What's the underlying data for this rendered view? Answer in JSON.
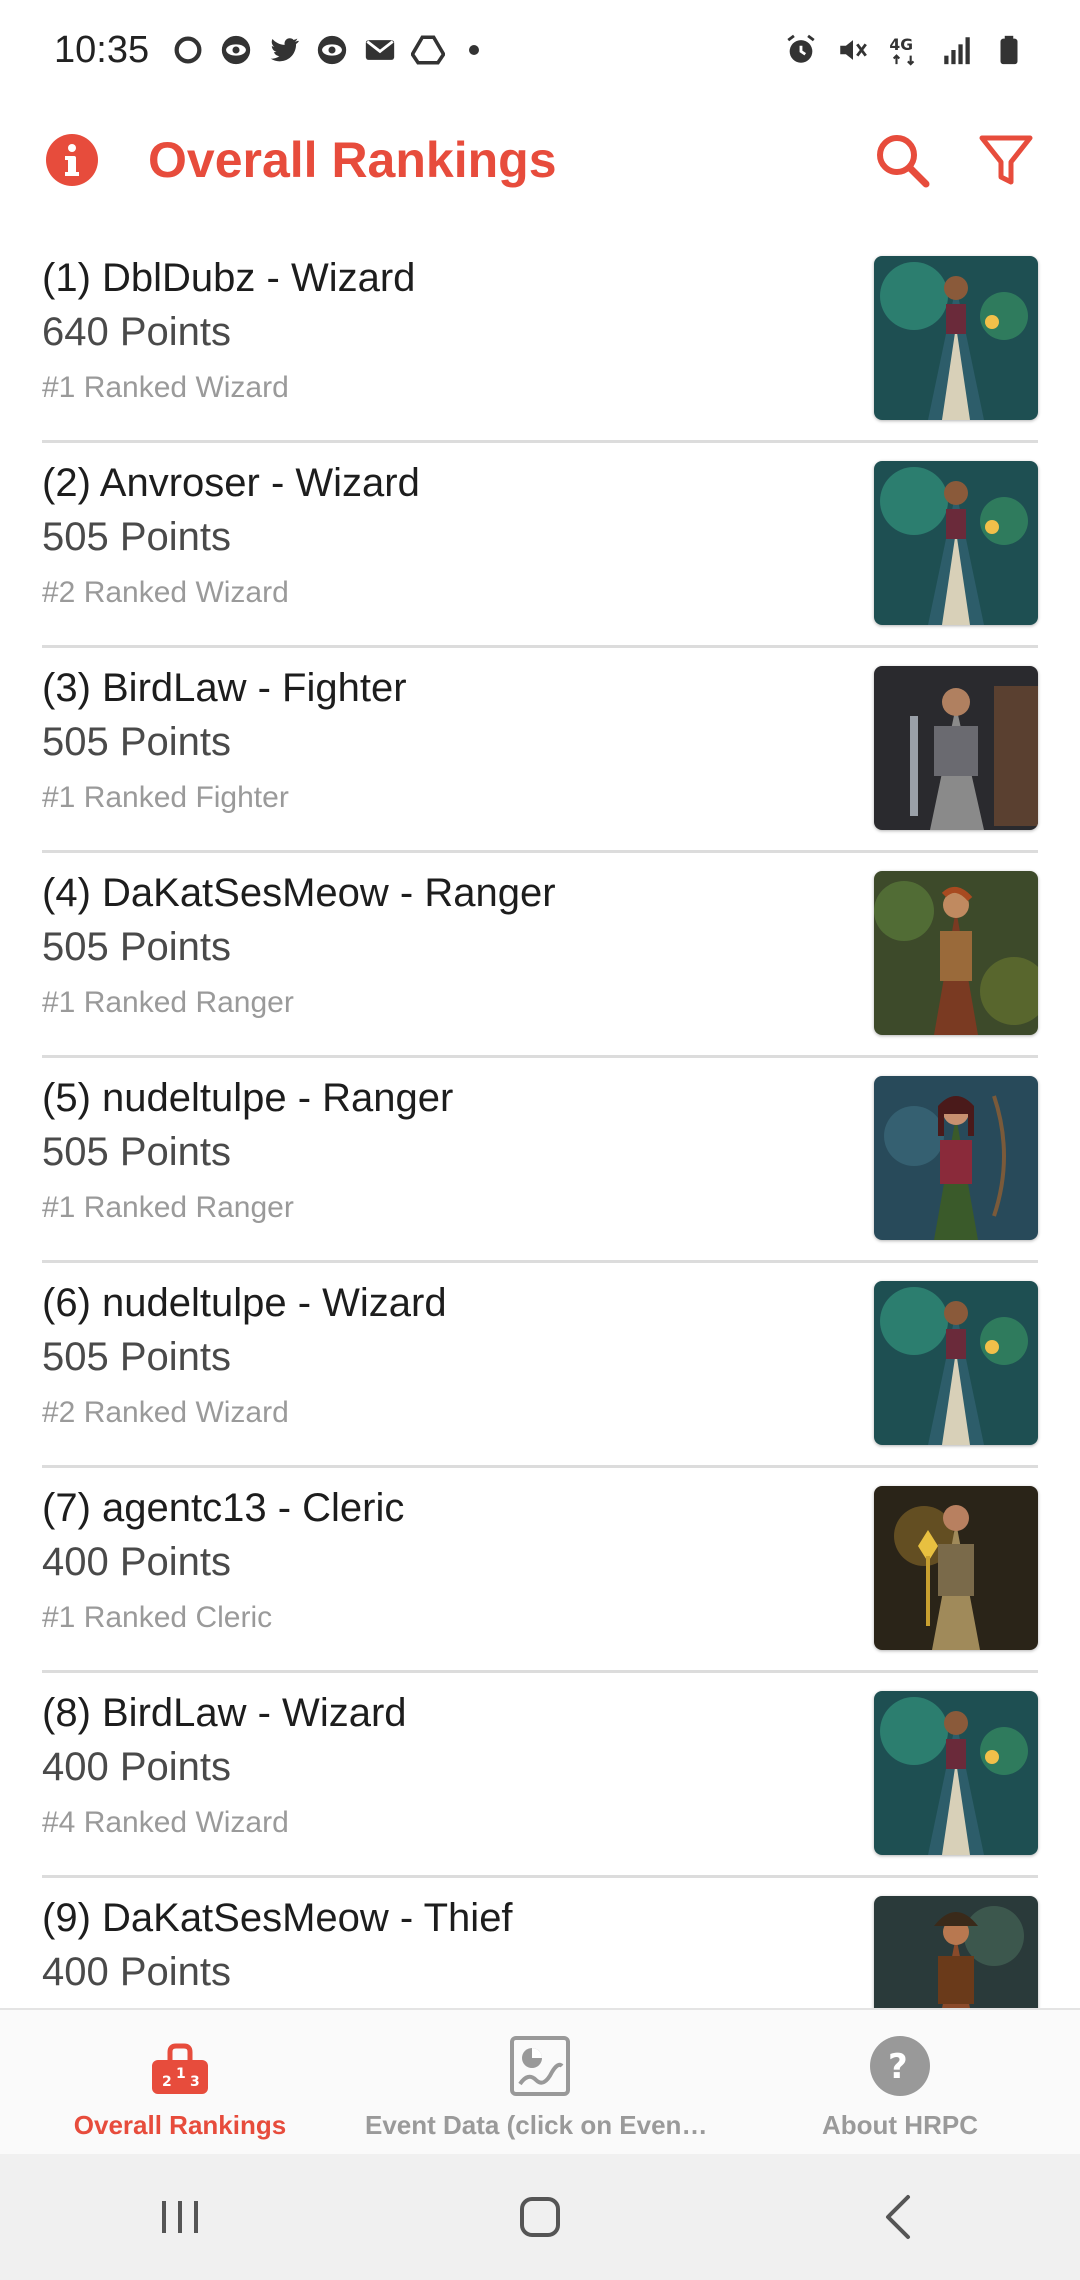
{
  "status_bar": {
    "time": "10:35",
    "left_icons": [
      "threads-icon",
      "eye-icon",
      "twitter-icon",
      "eye-icon",
      "mail-icon",
      "drive-icon"
    ],
    "right_icons": [
      "alarm-icon",
      "mute-icon",
      "lte-icon",
      "signal-icon",
      "battery-icon"
    ],
    "network": "4G LTE"
  },
  "app_bar": {
    "title": "Overall Rankings",
    "accent_color": "#e74c3c"
  },
  "rankings": [
    {
      "title": "(1) DblDubz - Wizard",
      "points": "640 Points",
      "rank": "#1 Ranked Wizard",
      "class": "wizard"
    },
    {
      "title": "(2) Anvroser - Wizard",
      "points": "505 Points",
      "rank": "#2 Ranked Wizard",
      "class": "wizard"
    },
    {
      "title": "(3) BirdLaw - Fighter",
      "points": "505 Points",
      "rank": "#1 Ranked Fighter",
      "class": "fighter"
    },
    {
      "title": "(4) DaKatSesMeow - Ranger",
      "points": "505 Points",
      "rank": "#1 Ranked Ranger",
      "class": "ranger"
    },
    {
      "title": "(5) nudeltulpe - Ranger",
      "points": "505 Points",
      "rank": "#1 Ranked Ranger",
      "class": "ranger2"
    },
    {
      "title": "(6) nudeltulpe - Wizard",
      "points": "505 Points",
      "rank": "#2 Ranked Wizard",
      "class": "wizard"
    },
    {
      "title": "(7) agentc13 - Cleric",
      "points": "400 Points",
      "rank": "#1 Ranked Cleric",
      "class": "cleric"
    },
    {
      "title": "(8) BirdLaw - Wizard",
      "points": "400 Points",
      "rank": "#4 Ranked Wizard",
      "class": "wizard"
    },
    {
      "title": "(9) DaKatSesMeow - Thief",
      "points": "400 Points",
      "rank": "",
      "class": "thief"
    }
  ],
  "bottom_nav": [
    {
      "label": "Overall Rankings",
      "icon": "podium-icon",
      "active": true
    },
    {
      "label": "Event Data (click on Event fo...",
      "icon": "chart-icon",
      "active": false
    },
    {
      "label": "About HRPC",
      "icon": "help-icon",
      "active": false
    }
  ]
}
